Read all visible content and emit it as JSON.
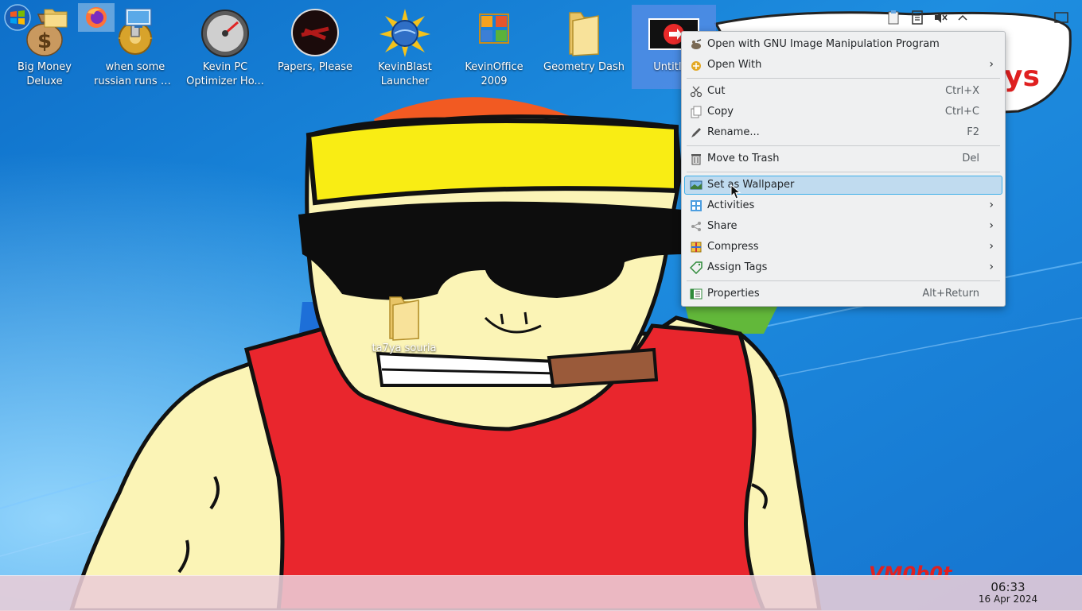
{
  "desktop": {
    "icons": [
      {
        "line1": "Big Money",
        "line2": "Deluxe",
        "icon": "money-bag-icon"
      },
      {
        "line1": "when some",
        "line2": "russian runs a...",
        "icon": "gear-icon"
      },
      {
        "line1": "Kevin PC",
        "line2": "Optimizer Ho...",
        "icon": "gauge-icon"
      },
      {
        "line1": "Papers, Please",
        "line2": "",
        "icon": "papers-please-icon"
      },
      {
        "line1": "KevinBlast",
        "line2": "Launcher",
        "icon": "kevinblast-icon"
      },
      {
        "line1": "KevinOffice",
        "line2": "2009",
        "icon": "office-icon"
      },
      {
        "line1": "Geometry Dash",
        "line2": "",
        "icon": "folder-icon"
      },
      {
        "line1": "Untitled",
        "line2": "",
        "icon": "image-file-icon"
      }
    ],
    "folder_on_wallpaper": {
      "label": "ta7ya souria",
      "icon": "folder-icon"
    },
    "wallpaper_text": {
      "top_right": "ys",
      "bottom_right": "VM0b0t"
    }
  },
  "context_menu": {
    "items": [
      {
        "label": "Open with GNU Image Manipulation Program",
        "shortcut": "",
        "submenu": false,
        "icon": "gimp-icon"
      },
      {
        "label": "Open With",
        "shortcut": "",
        "submenu": true,
        "icon": "open-with-icon"
      },
      {
        "label": "Cut",
        "shortcut": "Ctrl+X",
        "submenu": false,
        "icon": "scissors-icon"
      },
      {
        "label": "Copy",
        "shortcut": "Ctrl+C",
        "submenu": false,
        "icon": "copy-icon"
      },
      {
        "label": "Rename...",
        "shortcut": "F2",
        "submenu": false,
        "icon": "rename-icon"
      },
      {
        "label": "Move to Trash",
        "shortcut": "Del",
        "submenu": false,
        "icon": "trash-icon"
      },
      {
        "label": "Set as Wallpaper",
        "shortcut": "",
        "submenu": false,
        "icon": "wallpaper-icon",
        "highlighted": true
      },
      {
        "label": "Activities",
        "shortcut": "",
        "submenu": true,
        "icon": "activities-icon"
      },
      {
        "label": "Share",
        "shortcut": "",
        "submenu": true,
        "icon": "share-icon"
      },
      {
        "label": "Compress",
        "shortcut": "",
        "submenu": true,
        "icon": "compress-icon"
      },
      {
        "label": "Assign Tags",
        "shortcut": "",
        "submenu": true,
        "icon": "tag-icon"
      },
      {
        "label": "Properties",
        "shortcut": "Alt+Return",
        "submenu": false,
        "icon": "properties-icon"
      }
    ],
    "submenu_arrow": "›"
  },
  "taskbar": {
    "buttons": [
      {
        "name": "start-menu-button",
        "icon": "windows-start-icon"
      },
      {
        "name": "file-manager-button",
        "icon": "folder-icon"
      },
      {
        "name": "firefox-button",
        "icon": "firefox-icon"
      },
      {
        "name": "system-settings-button",
        "icon": "monitor-icon"
      }
    ],
    "tray": [
      "clipboard-icon",
      "notes-icon",
      "volume-muted-icon",
      "chevron-up-icon"
    ],
    "clock": {
      "time": "06:33",
      "date": "16 Apr 2024"
    }
  },
  "colors": {
    "menu_bg": "#eff0f1",
    "menu_highlight": "#c0dbef",
    "menu_highlight_border": "#3daee9",
    "taskbar_bg": "#ebcdd7",
    "wallpaper_sky": "#1e88d8"
  }
}
